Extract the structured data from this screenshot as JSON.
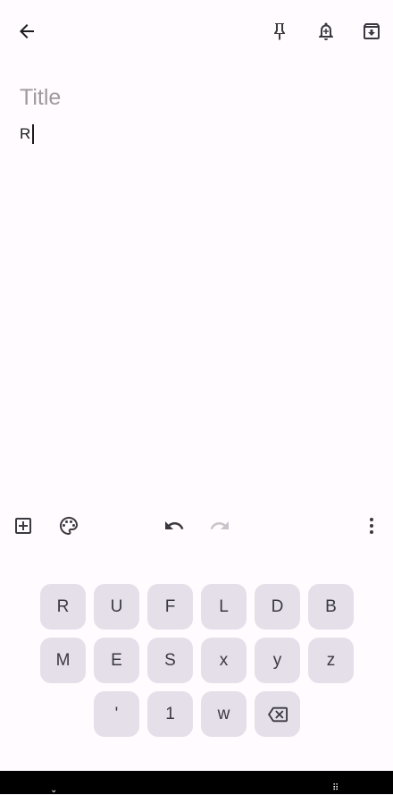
{
  "app_bar": {
    "back_icon": "arrow-back-icon",
    "pin_icon": "pin-icon",
    "reminder_icon": "bell-plus-icon",
    "archive_icon": "archive-icon"
  },
  "note": {
    "title_placeholder": "Title",
    "title_value": "",
    "body_text": "R"
  },
  "toolbar": {
    "add_icon": "add-box-icon",
    "palette_icon": "palette-icon",
    "undo_icon": "undo-icon",
    "redo_icon": "redo-icon",
    "more_icon": "more-vert-icon"
  },
  "keyboard": {
    "row1": [
      "R",
      "U",
      "F",
      "L",
      "D",
      "B"
    ],
    "row2": [
      "M",
      "E",
      "S",
      "x",
      "y",
      "z"
    ],
    "row3": [
      "'",
      "1",
      "w"
    ],
    "backspace_icon": "backspace-icon"
  },
  "colors": {
    "background": "#fffbfe",
    "key_background": "#e4dfe9",
    "placeholder": "#9e9a9f",
    "nav_bar": "#000000"
  }
}
